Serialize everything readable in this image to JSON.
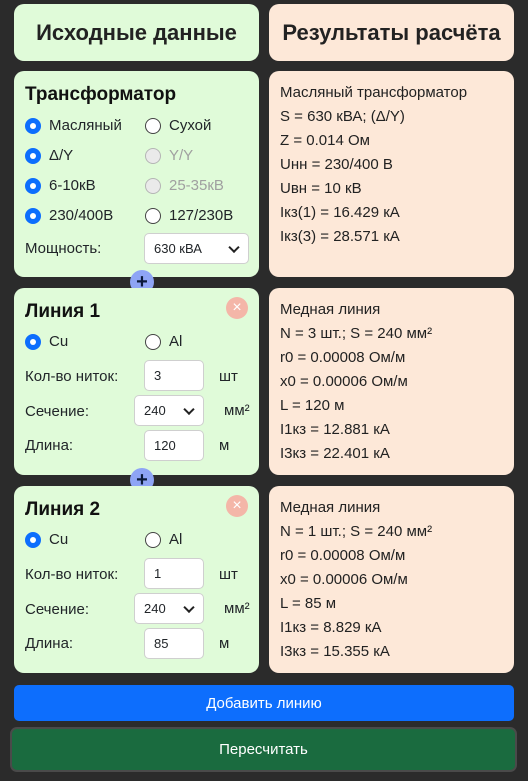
{
  "headers": {
    "input_title": "Исходные данные",
    "results_title": "Результаты расчёта"
  },
  "transformer": {
    "title": "Трансформатор",
    "type_options": [
      "Масляный",
      "Сухой"
    ],
    "connection_options": [
      "Δ/Y",
      "Y/Y"
    ],
    "hv_options": [
      "6-10кВ",
      "25-35кВ"
    ],
    "lv_options": [
      "230/400В",
      "127/230В"
    ],
    "power_label": "Мощность:",
    "power_value": "630 кВА"
  },
  "transformer_results": [
    "Масляный трансформатор",
    "S = 630 кВА; (Δ/Y)",
    "Z = 0.014 Ом",
    "Uнн = 230/400 В",
    "Uвн = 10 кВ",
    "Iкз(1) = 16.429 кА",
    "Iкз(3) = 28.571 кА"
  ],
  "lines": [
    {
      "title": "Линия 1",
      "materials": [
        "Cu",
        "Al"
      ],
      "strands_label": "Кол-во ниток:",
      "strands_value": "3",
      "strands_unit": "шт",
      "section_label": "Сечение:",
      "section_value": "240",
      "section_unit": "мм²",
      "length_label": "Длина:",
      "length_value": "120",
      "length_unit": "м",
      "results": [
        "Медная линия",
        "N = 3 шт.; S = 240 мм²",
        "r0 = 0.00008 Ом/м",
        "x0 = 0.00006 Ом/м",
        "L = 120 м",
        "I1кз = 12.881 кА",
        "I3кз = 22.401 кА"
      ]
    },
    {
      "title": "Линия 2",
      "materials": [
        "Cu",
        "Al"
      ],
      "strands_label": "Кол-во ниток:",
      "strands_value": "1",
      "strands_unit": "шт",
      "section_label": "Сечение:",
      "section_value": "240",
      "section_unit": "мм²",
      "length_label": "Длина:",
      "length_value": "85",
      "length_unit": "м",
      "results": [
        "Медная линия",
        "N = 1 шт.; S = 240 мм²",
        "r0 = 0.00008 Ом/м",
        "x0 = 0.00006 Ом/м",
        "L = 85 м",
        "I1кз = 8.829 кА",
        "I3кз = 15.355 кА"
      ]
    }
  ],
  "plus_symbol": "+",
  "close_symbol": "×",
  "buttons": {
    "add_line": "Добавить линию",
    "recalculate": "Пересчитать"
  },
  "colors": {
    "input_bg": "#e0fbd9",
    "result_bg": "#fde8d8",
    "accent": "#0d6efd",
    "recalc": "#1a6b3f"
  }
}
